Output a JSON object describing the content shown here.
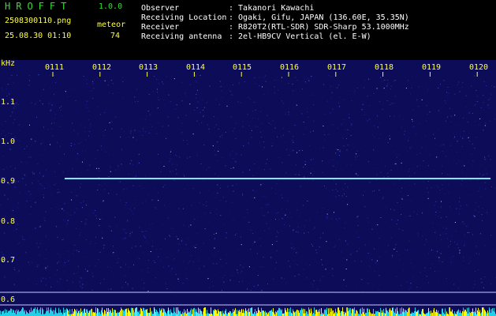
{
  "header": {
    "app_name": "HROFFT",
    "app_version": "1.0.0",
    "filename": "2508300110.png",
    "datetime": "25.08.30 01:10",
    "counter_label": "meteor",
    "counter_value": "74",
    "info": [
      {
        "label": "Observer",
        "value": ": Takanori Kawachi"
      },
      {
        "label": "Receiving Location",
        "value": ": Ogaki, Gifu, JAPAN (136.60E, 35.35N)"
      },
      {
        "label": "Receiver",
        "value": ": R820T2(RTL-SDR) SDR-Sharp 53.1000MHz"
      },
      {
        "label": "Receiving antenna",
        "value": ": 2el-HB9CV Vertical (el. E-W)"
      }
    ]
  },
  "spectrogram": {
    "unit_label": "kHz",
    "time_ticks": [
      "0111",
      "0112",
      "0113",
      "0114",
      "0115",
      "0116",
      "0117",
      "0118",
      "0119",
      "0120"
    ],
    "freq_ticks": [
      "1.1",
      "1.0",
      "0.9",
      "0.8",
      "0.7",
      "0.6"
    ],
    "colors": {
      "background": "#0c0c58",
      "signal": "#7fe8ff",
      "labels": "#ffff40",
      "meter": "#ffff00"
    }
  }
}
